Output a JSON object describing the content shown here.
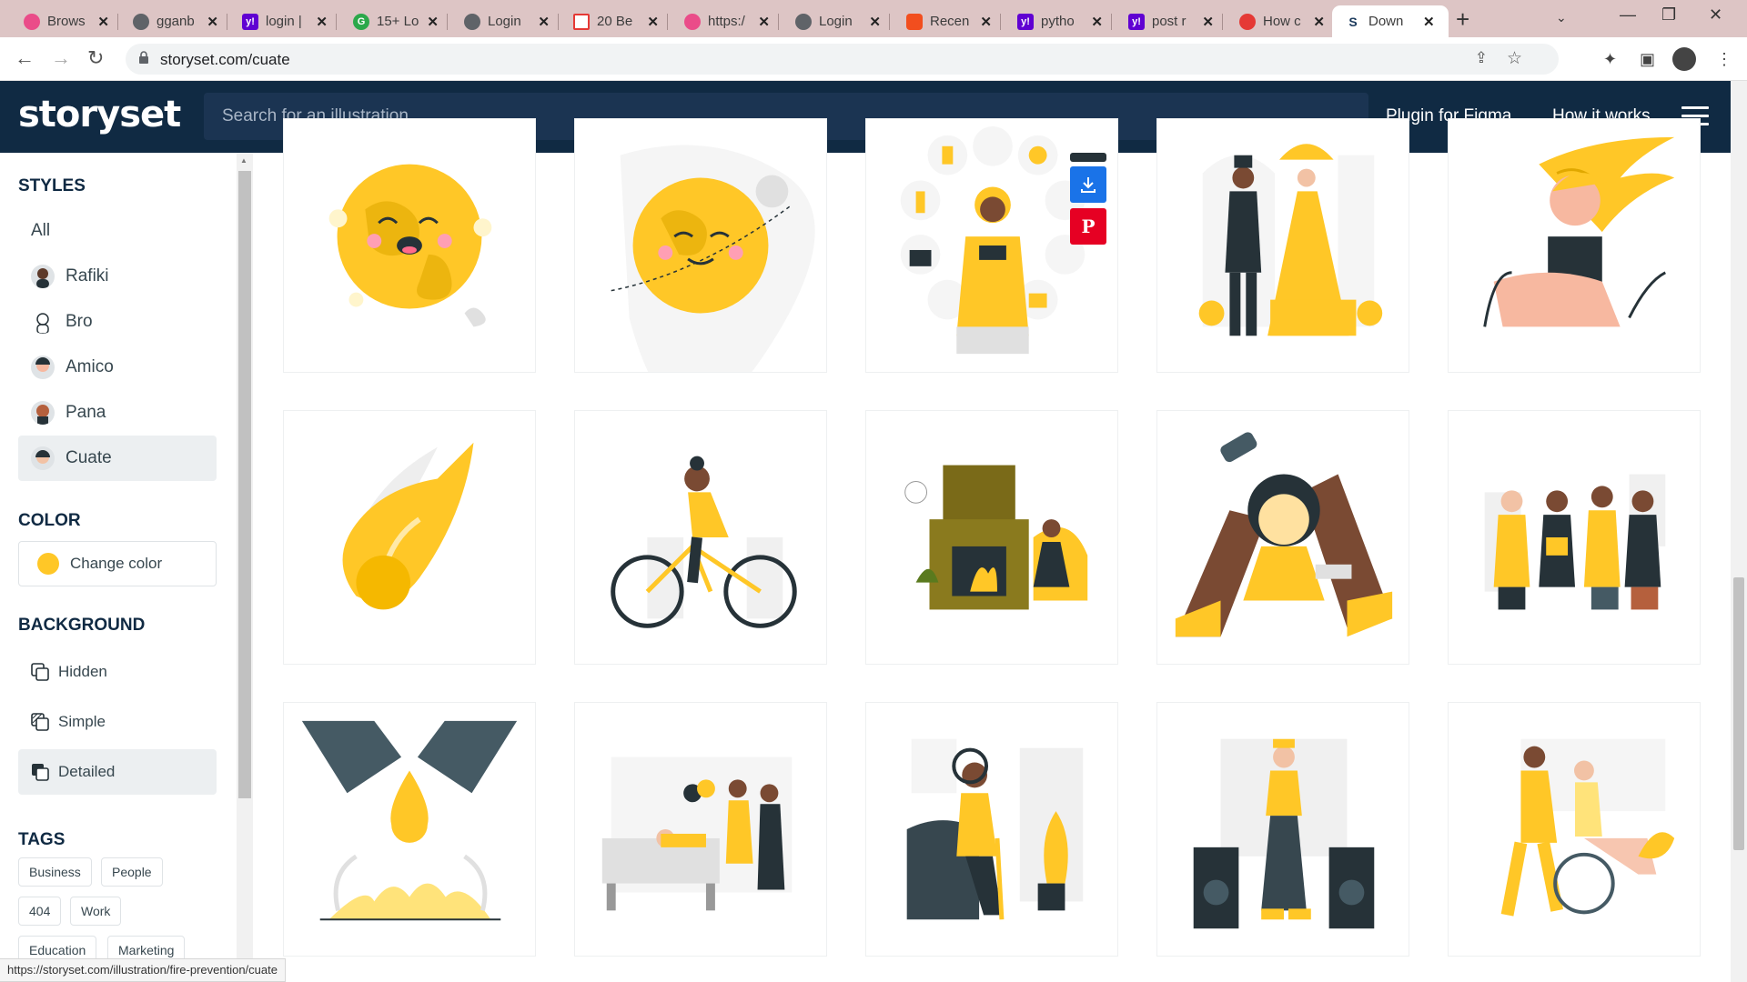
{
  "browser": {
    "tabs": [
      {
        "title": "Brows",
        "favicon_color": "#ea4c89"
      },
      {
        "title": "gganb",
        "favicon_color": "#5f6368"
      },
      {
        "title": "login |",
        "favicon_color": "#6001d2"
      },
      {
        "title": "15+ Lo",
        "favicon_color": "#2ba84a"
      },
      {
        "title": "Login",
        "favicon_color": "#5f6368"
      },
      {
        "title": "20 Be",
        "favicon_color": "#e53935"
      },
      {
        "title": "https:/",
        "favicon_color": "#ea4c89"
      },
      {
        "title": "Login",
        "favicon_color": "#5f6368"
      },
      {
        "title": "Recen",
        "favicon_color": "#f24e1e"
      },
      {
        "title": "pytho",
        "favicon_color": "#6001d2"
      },
      {
        "title": "post r",
        "favicon_color": "#6001d2"
      },
      {
        "title": "How c",
        "favicon_color": "#e53935"
      },
      {
        "title": "Down",
        "favicon_color": "#1b3a5c"
      }
    ],
    "url": "storyset.com/cuate",
    "status_url": "https://storyset.com/illustration/fire-prevention/cuate"
  },
  "site": {
    "logo": "storyset",
    "search_placeholder": "Search for an illustration",
    "links": [
      "Plugin for Figma",
      "How it works"
    ]
  },
  "sidebar": {
    "styles_heading": "STYLES",
    "styles": [
      {
        "label": "All",
        "selected": false
      },
      {
        "label": "Rafiki",
        "selected": false
      },
      {
        "label": "Bro",
        "selected": false
      },
      {
        "label": "Amico",
        "selected": false
      },
      {
        "label": "Pana",
        "selected": false
      },
      {
        "label": "Cuate",
        "selected": true
      }
    ],
    "color_heading": "COLOR",
    "color_button": "Change color",
    "accent": "#ffc727",
    "background_heading": "BACKGROUND",
    "backgrounds": [
      {
        "label": "Hidden",
        "selected": false
      },
      {
        "label": "Simple",
        "selected": false
      },
      {
        "label": "Detailed",
        "selected": true
      }
    ],
    "tags_heading": "TAGS",
    "tags": [
      "Business",
      "People",
      "404",
      "Work",
      "Education",
      "Marketing"
    ]
  },
  "illustrations": [
    "smiling-earth",
    "earth-with-moon",
    "fire-prevention",
    "victorian-couple",
    "windy-hair-woman",
    "meteor-fire",
    "cyclist",
    "fireplace-reading",
    "doll-sewing",
    "team-reading",
    "falling-drop",
    "hospital-visit",
    "elderly-reading",
    "dj-speakers",
    "wheelchair-walk"
  ]
}
